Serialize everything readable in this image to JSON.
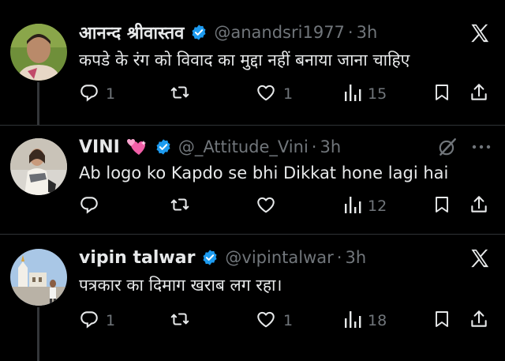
{
  "tweets": [
    {
      "name": "आनन्द श्रीवास्तव",
      "handle": "@anandsri1977",
      "separator": "·",
      "time": "3h",
      "text": "कपडे के रंग को विवाद का मुद्दा नहीं बनाया जाना चाहिए",
      "replies": "1",
      "retweets": "",
      "likes": "1",
      "views": "15"
    },
    {
      "name": "VINI",
      "handle": "@_Attitude_Vini",
      "separator": "·",
      "time": "3h",
      "text": "Ab logo ko Kapdo se bhi Dikkat hone lagi hai",
      "replies": "",
      "retweets": "",
      "likes": "",
      "views": "12"
    },
    {
      "name": "vipin talwar",
      "handle": "@vipintalwar",
      "separator": "·",
      "time": "3h",
      "text": "पत्रकार का दिमाग खराब लग रहा।",
      "replies": "1",
      "retweets": "",
      "likes": "1",
      "views": "18"
    }
  ],
  "icons": [
    "x-logo-icon",
    "verified-badge-icon",
    "reply-icon",
    "retweet-icon",
    "like-icon",
    "views-icon",
    "bookmark-icon",
    "share-icon",
    "grok-icon",
    "more-icon",
    "hearts-emoji-icon"
  ],
  "colors": {
    "background": "#000000",
    "text": "#e7e9ea",
    "muted": "#71767b",
    "verified": "#1d9bf0",
    "divider": "#2f3336"
  }
}
